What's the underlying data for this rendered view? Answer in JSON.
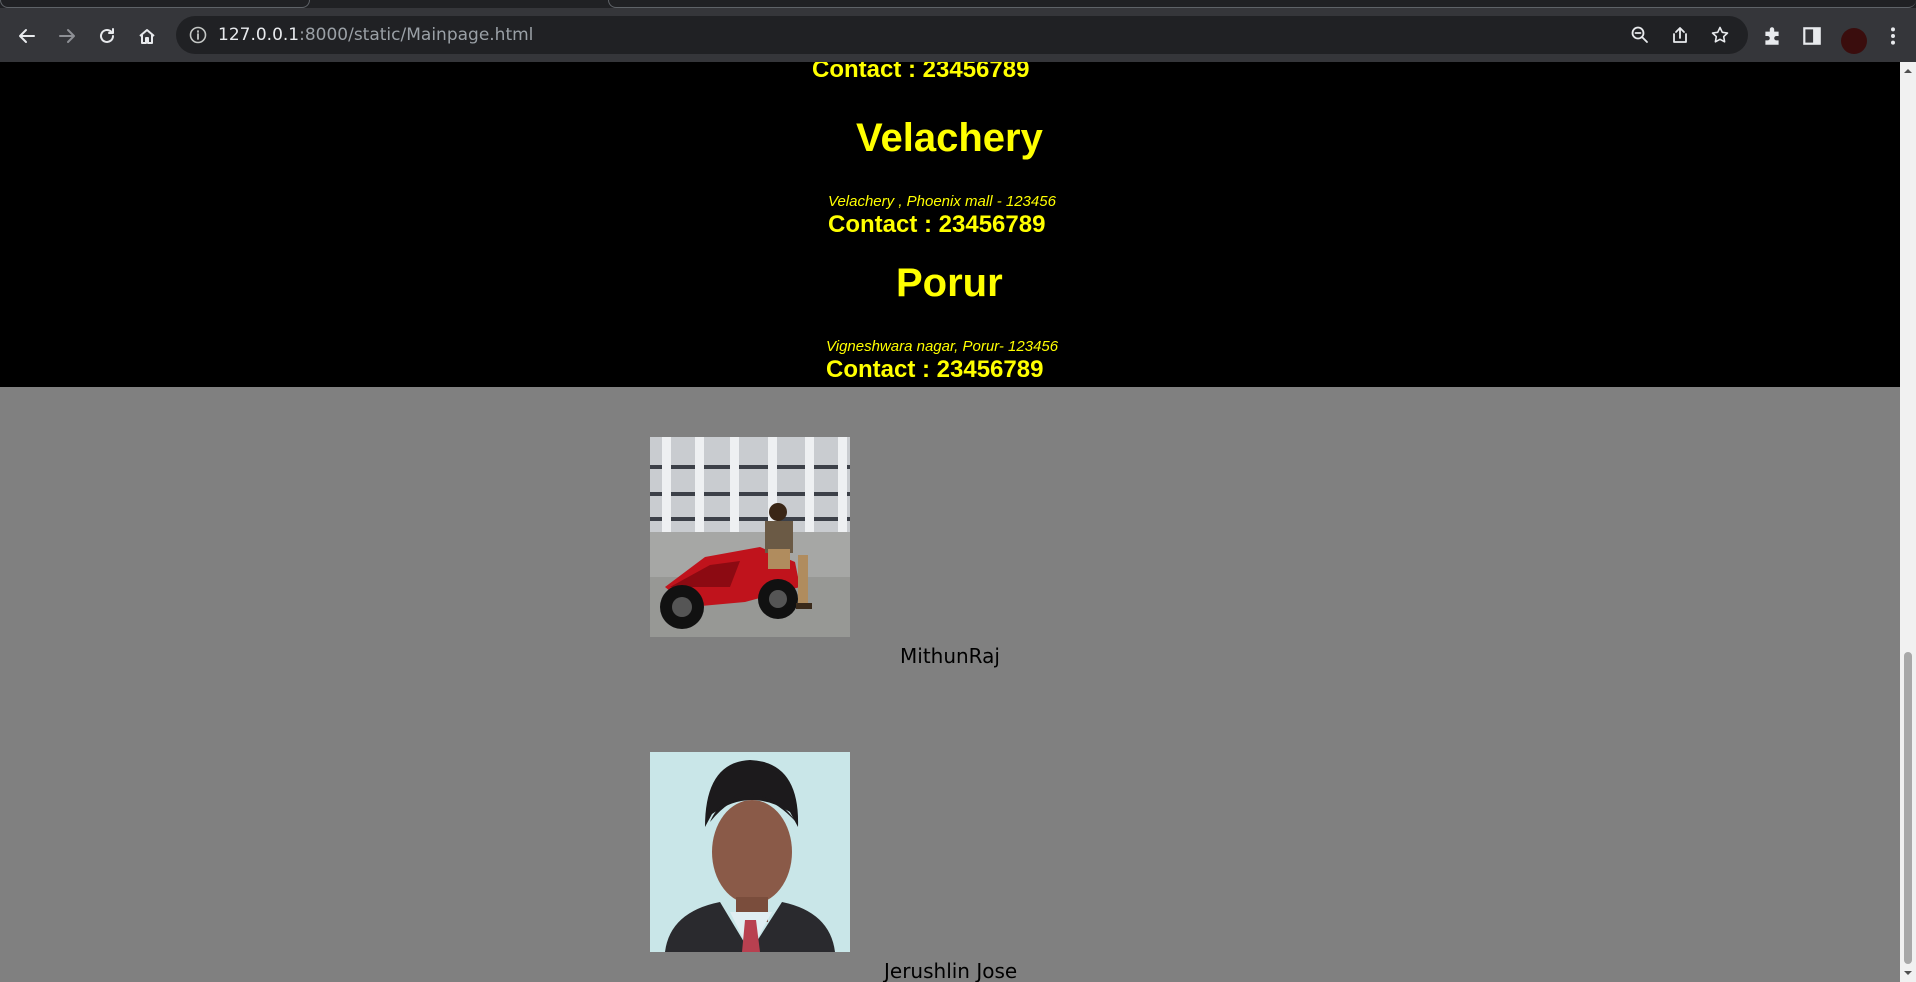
{
  "browser": {
    "url_host": "127.0.0.1",
    "url_path": ":8000/static/Mainpage.html"
  },
  "page": {
    "top_contact": "Contact : 23456789",
    "branches": [
      {
        "name": "Velachery",
        "address": "Velachery , Phoenix mall - 123456",
        "contact": "Contact : 23456789"
      },
      {
        "name": "Porur",
        "address": "Vigneshwara nagar, Porur- 123456",
        "contact": "Contact : 23456789"
      }
    ],
    "team": [
      {
        "name": "MithunRaj"
      },
      {
        "name": "Jerushlin Jose"
      }
    ]
  }
}
